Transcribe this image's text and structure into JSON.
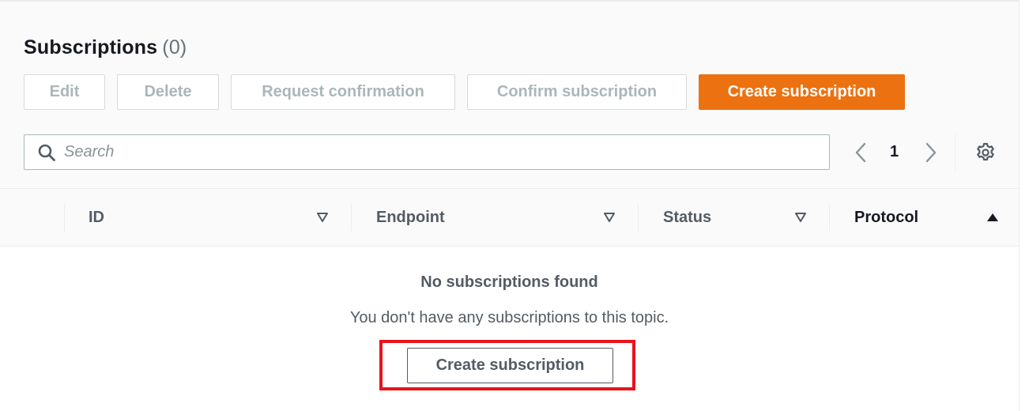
{
  "header": {
    "title": "Subscriptions",
    "count": "(0)"
  },
  "toolbar": {
    "edit_label": "Edit",
    "delete_label": "Delete",
    "request_confirmation_label": "Request confirmation",
    "confirm_subscription_label": "Confirm subscription",
    "create_subscription_label": "Create subscription"
  },
  "search": {
    "placeholder": "Search",
    "value": ""
  },
  "pagination": {
    "current_page": "1",
    "prev_icon": "chevron-left-icon",
    "next_icon": "chevron-right-icon",
    "settings_icon": "gear-icon"
  },
  "table": {
    "columns": [
      {
        "label": "ID",
        "sort": "sortable"
      },
      {
        "label": "Endpoint",
        "sort": "sortable"
      },
      {
        "label": "Status",
        "sort": "sortable"
      },
      {
        "label": "Protocol",
        "sort": "ascending"
      }
    ],
    "rows": []
  },
  "empty_state": {
    "title": "No subscriptions found",
    "description": "You don't have any subscriptions to this topic.",
    "button_label": "Create subscription"
  },
  "colors": {
    "primary": "#ec7211",
    "disabled_text": "#aab7b8",
    "highlight": "#e8141c"
  }
}
